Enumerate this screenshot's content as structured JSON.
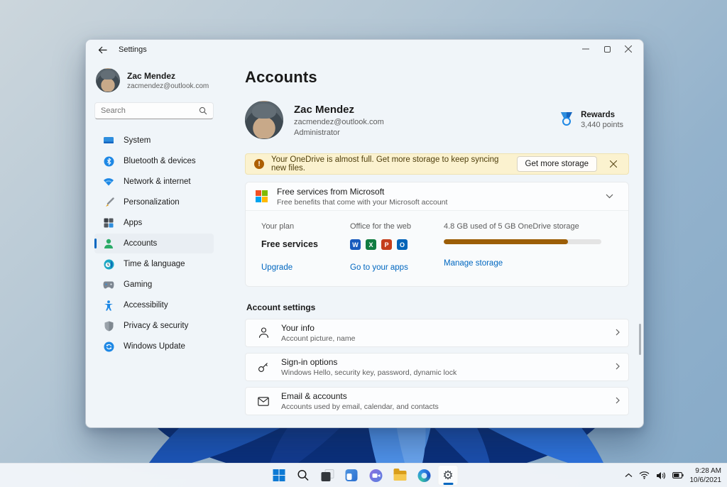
{
  "window": {
    "title": "Settings"
  },
  "sidebar": {
    "user": {
      "name": "Zac Mendez",
      "email": "zacmendez@outlook.com"
    },
    "search": {
      "placeholder": "Search"
    },
    "items": [
      {
        "label": "System",
        "icon": "system-icon",
        "selected": false
      },
      {
        "label": "Bluetooth & devices",
        "icon": "bluetooth-icon",
        "selected": false
      },
      {
        "label": "Network & internet",
        "icon": "network-icon",
        "selected": false
      },
      {
        "label": "Personalization",
        "icon": "personalization-icon",
        "selected": false
      },
      {
        "label": "Apps",
        "icon": "apps-icon",
        "selected": false
      },
      {
        "label": "Accounts",
        "icon": "accounts-icon",
        "selected": true
      },
      {
        "label": "Time & language",
        "icon": "time-language-icon",
        "selected": false
      },
      {
        "label": "Gaming",
        "icon": "gaming-icon",
        "selected": false
      },
      {
        "label": "Accessibility",
        "icon": "accessibility-icon",
        "selected": false
      },
      {
        "label": "Privacy & security",
        "icon": "privacy-icon",
        "selected": false
      },
      {
        "label": "Windows Update",
        "icon": "windows-update-icon",
        "selected": false
      }
    ]
  },
  "main": {
    "title": "Accounts",
    "profile": {
      "name": "Zac Mendez",
      "email": "zacmendez@outlook.com",
      "role": "Administrator"
    },
    "rewards": {
      "label": "Rewards",
      "points": "3,440 points"
    },
    "banner": {
      "text": "Your OneDrive is almost full. Get more storage to keep syncing new files.",
      "button": "Get more storage"
    },
    "expander": {
      "title": "Free services from Microsoft",
      "subtitle": "Free benefits that come with your Microsoft account"
    },
    "plan": {
      "your_plan_label": "Your plan",
      "your_plan_value": "Free services",
      "upgrade_link": "Upgrade",
      "office_label": "Office for the web",
      "office_apps": [
        {
          "letter": "W",
          "color": "#185abd",
          "name": "word"
        },
        {
          "letter": "X",
          "color": "#107c41",
          "name": "excel"
        },
        {
          "letter": "P",
          "color": "#c43e1c",
          "name": "powerpoint"
        },
        {
          "letter": "O",
          "color": "#0364b8",
          "name": "outlook"
        }
      ],
      "office_link": "Go to your apps",
      "storage_label": "4.8 GB used of 5 GB OneDrive storage",
      "storage_pct": 79,
      "storage_link": "Manage storage"
    },
    "section_title": "Account settings",
    "rows": [
      {
        "title": "Your info",
        "subtitle": "Account picture, name",
        "icon": "person-icon"
      },
      {
        "title": "Sign-in options",
        "subtitle": "Windows Hello, security key, password, dynamic lock",
        "icon": "key-icon"
      },
      {
        "title": "Email & accounts",
        "subtitle": "Accounts used by email, calendar, and contacts",
        "icon": "envelope-icon"
      }
    ]
  },
  "taskbar": {
    "icons": [
      "start",
      "search",
      "task-view",
      "widgets",
      "chat",
      "file-explorer",
      "edge",
      "settings"
    ],
    "active_icon": "settings",
    "tray": {
      "time": "9:28 AM",
      "date": "10/6/2021"
    }
  },
  "colors": {
    "accent": "#0067c0",
    "banner_bg": "#fbf2cf",
    "warning": "#ad5f00",
    "progress_fill": "#9c5e07"
  }
}
